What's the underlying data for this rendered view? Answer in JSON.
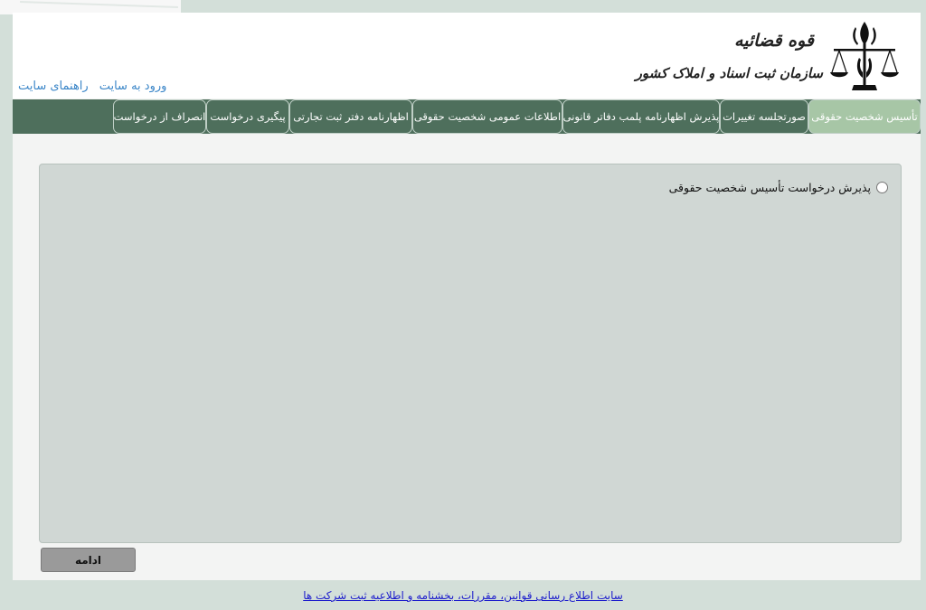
{
  "header": {
    "logo_line1": "قوه قضائیه",
    "logo_line2": "سازمان ثبت اسناد و املاک کشور",
    "links": [
      "ورود به سایت",
      "راهنمای سایت"
    ]
  },
  "nav": {
    "tabs": [
      "تأسیس شخصیت حقوقی",
      "صورتجلسه تغییرات",
      "پذیرش اظهارنامه پلمب دفاتر قانونی",
      "اطلاعات عمومی شخصیت حقوقی",
      "اظهارنامه دفتر ثبت تجارتی",
      "پیگیری درخواست",
      "انصراف از درخواست"
    ],
    "active_index": 0
  },
  "main": {
    "option_label": "پذیرش درخواست تأسیس شخصیت حقوقی",
    "continue_button": "ادامه"
  },
  "footer": {
    "link_text": "سایت اطلاع رسانی قوانین، مقررات، بخشنامه و اطلاعیه ثبت شرکت ها"
  },
  "colors": {
    "nav_bg": "#4e6f5c",
    "active_tab": "#a7c6a6",
    "link": "#3b86c8",
    "panel": "#d0d7d4"
  }
}
